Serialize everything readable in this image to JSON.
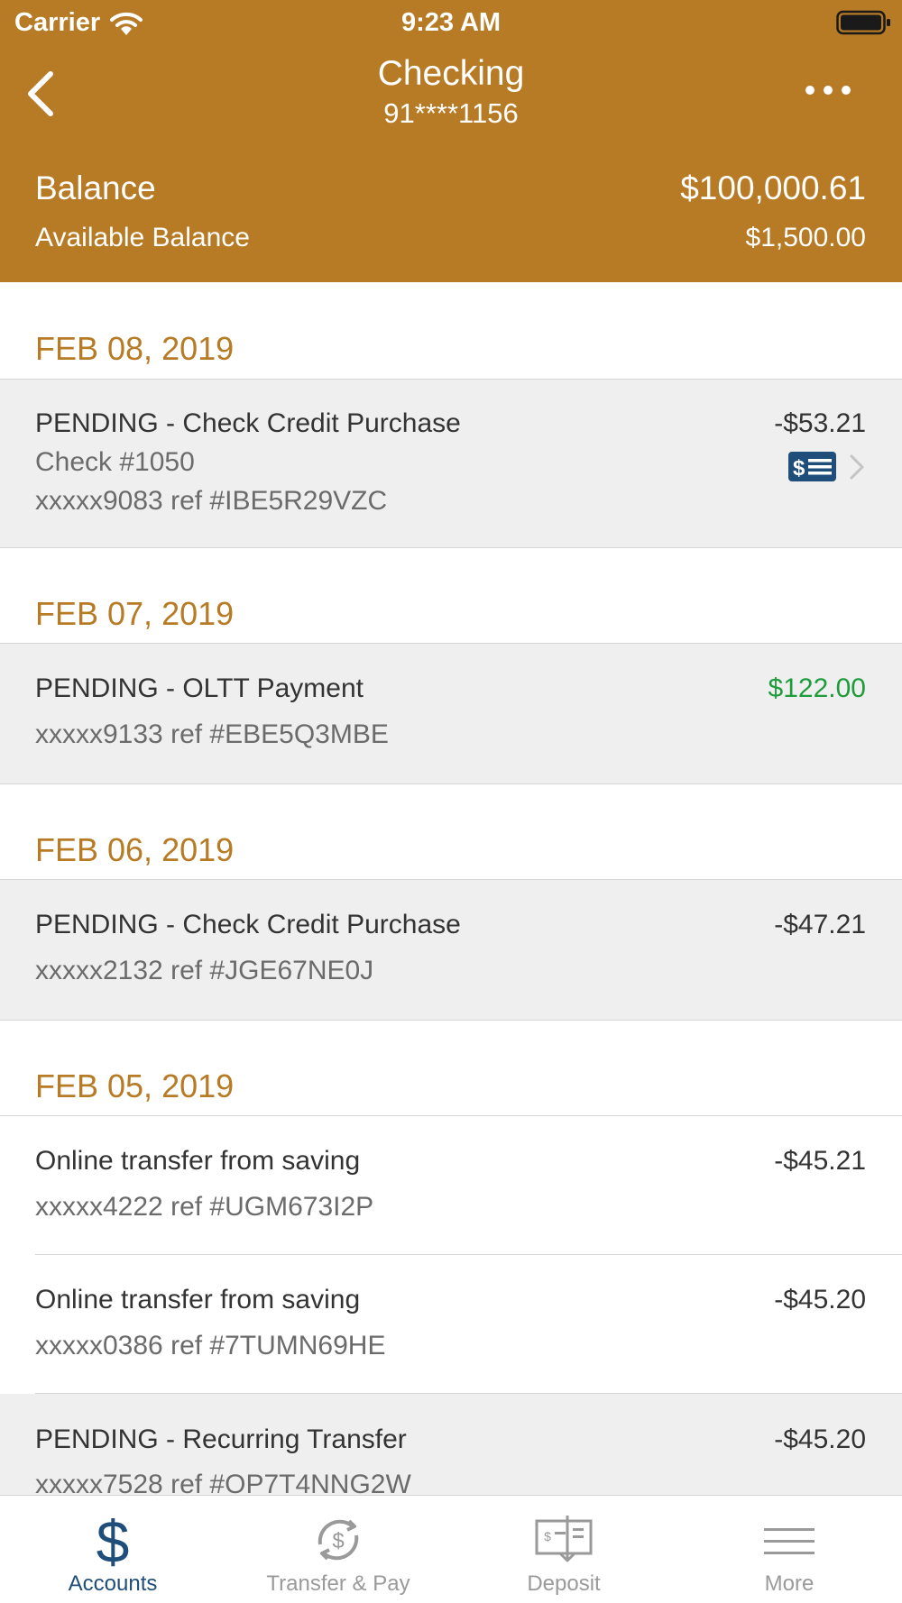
{
  "status_bar": {
    "carrier": "Carrier",
    "time": "9:23 AM"
  },
  "nav": {
    "title": "Checking",
    "subtitle": "91****1156"
  },
  "summary": {
    "balance_label": "Balance",
    "balance_value": "$100,000.61",
    "available_label": "Available Balance",
    "available_value": "$1,500.00"
  },
  "groups": [
    {
      "date": "FEB 08, 2019",
      "transactions": [
        {
          "title": "PENDING - Check Credit Purchase",
          "check": "Check #1050",
          "ref": "xxxxx9083 ref #IBE5R29VZC",
          "amount": "-$53.21"
        }
      ]
    },
    {
      "date": "FEB 07, 2019",
      "transactions": [
        {
          "title": "PENDING - OLTT Payment",
          "ref": "xxxxx9133 ref #EBE5Q3MBE",
          "amount": "$122.00"
        }
      ]
    },
    {
      "date": "FEB 06, 2019",
      "transactions": [
        {
          "title": "PENDING - Check Credit Purchase",
          "ref": "xxxxx2132 ref #JGE67NE0J",
          "amount": "-$47.21"
        }
      ]
    },
    {
      "date": "FEB 05, 2019",
      "transactions": [
        {
          "title": "Online transfer from saving",
          "ref": "xxxxx4222 ref #UGM673I2P",
          "amount": "-$45.21"
        },
        {
          "title": "Online transfer from saving",
          "ref": "xxxxx0386 ref #7TUMN69HE",
          "amount": "-$45.20"
        },
        {
          "title": "PENDING - Recurring Transfer",
          "ref": "xxxxx7528 ref #OP7T4NNG2W",
          "amount": "-$45.20"
        }
      ]
    }
  ],
  "tabs": [
    {
      "label": "Accounts",
      "icon": "dollar-icon",
      "active": true
    },
    {
      "label": "Transfer & Pay",
      "icon": "transfer-pay-icon",
      "active": false
    },
    {
      "label": "Deposit",
      "icon": "check-deposit-icon",
      "active": false
    },
    {
      "label": "More",
      "icon": "menu-icon",
      "active": false
    }
  ],
  "colors": {
    "brand": "#b77b25",
    "credit": "#1e9b3a",
    "active_tab": "#1f4e7a",
    "inactive_tab": "#9a9a9a",
    "row_pending": "#efefef"
  }
}
